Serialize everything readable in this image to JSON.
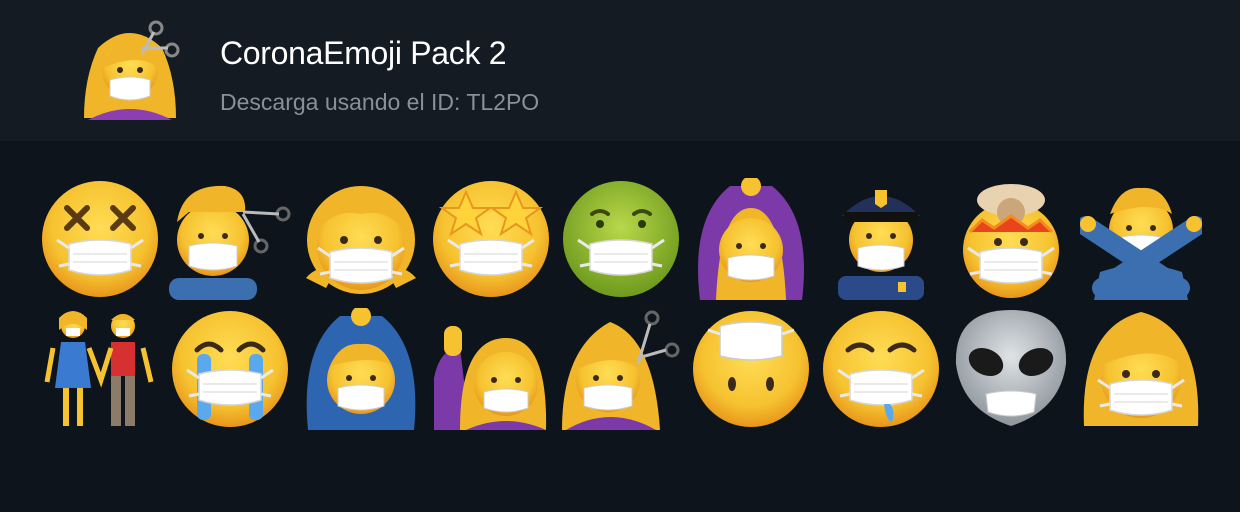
{
  "pack": {
    "title": "CoronaEmoji Pack 2",
    "subtitle": "Descarga usando el ID: TL2PO",
    "icon": "woman-haircut-mask-sticker"
  },
  "colors": {
    "background": "#0e141c",
    "header": "#141b23",
    "title": "#ffffff",
    "subtitle": "#8a9097",
    "emoji_yellow": "#f6c230",
    "mask": "#ffffff"
  },
  "stickers": [
    {
      "row": 1,
      "name": "dizzy-face-mask"
    },
    {
      "row": 1,
      "name": "man-haircut-mask"
    },
    {
      "row": 1,
      "name": "girl-mask"
    },
    {
      "row": 1,
      "name": "star-struck-mask"
    },
    {
      "row": 1,
      "name": "nauseated-face-mask"
    },
    {
      "row": 1,
      "name": "woman-ok-gesture-mask"
    },
    {
      "row": 1,
      "name": "police-officer-mask"
    },
    {
      "row": 1,
      "name": "exploding-head-mask"
    },
    {
      "row": 1,
      "name": "man-no-gesture-mask"
    },
    {
      "row": 2,
      "name": "couple-holding-hands-mask"
    },
    {
      "row": 2,
      "name": "crying-face-mask"
    },
    {
      "row": 2,
      "name": "man-ok-gesture-mask"
    },
    {
      "row": 2,
      "name": "woman-raising-hand-mask"
    },
    {
      "row": 2,
      "name": "woman-haircut-mask"
    },
    {
      "row": 2,
      "name": "face-with-mask-over-eyes"
    },
    {
      "row": 2,
      "name": "drooling-face-mask"
    },
    {
      "row": 2,
      "name": "alien-mask"
    },
    {
      "row": 2,
      "name": "woman-mask"
    }
  ]
}
